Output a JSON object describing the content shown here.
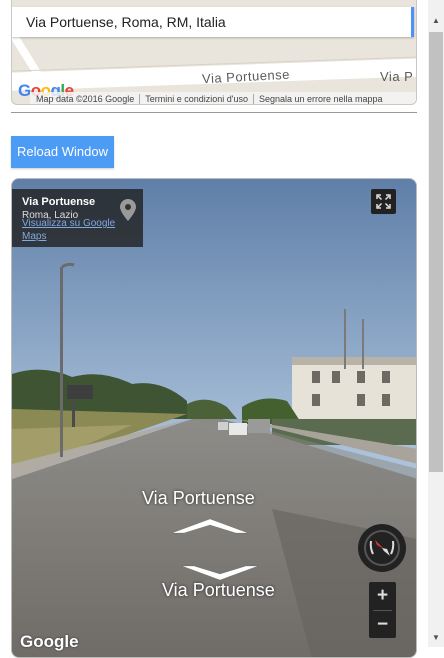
{
  "map": {
    "search_value": "Via Portuense, Roma, RM, Italia",
    "road_label_1": "Via Portuense",
    "road_label_2": "Via P",
    "logo": "Google",
    "footer": {
      "map_data": "Map data ©2016 Google",
      "terms": "Termini e condizioni d'uso",
      "report": "Segnala un errore nella mappa"
    }
  },
  "reload_button_label": "Reload Window",
  "street_view": {
    "info": {
      "title": "Via Portuense",
      "subtitle": "Roma, Lazio",
      "link": "Visualizza su Google Maps"
    },
    "nav_labels": {
      "forward": "Via Portuense",
      "backward": "Via Portuense"
    },
    "zoom_in_label": "+",
    "zoom_out_label": "−",
    "logo": "Google",
    "icons": [
      "map-pin-icon",
      "fullscreen-icon",
      "compass-icon",
      "chevron-up-icon",
      "chevron-down-icon"
    ]
  },
  "scrollbar": {
    "up_arrow": "▲",
    "down_arrow": "▼"
  },
  "colors": {
    "accent_button": "#4c9bf5",
    "search_accent": "#4d90fe",
    "link": "#82a8e0"
  }
}
